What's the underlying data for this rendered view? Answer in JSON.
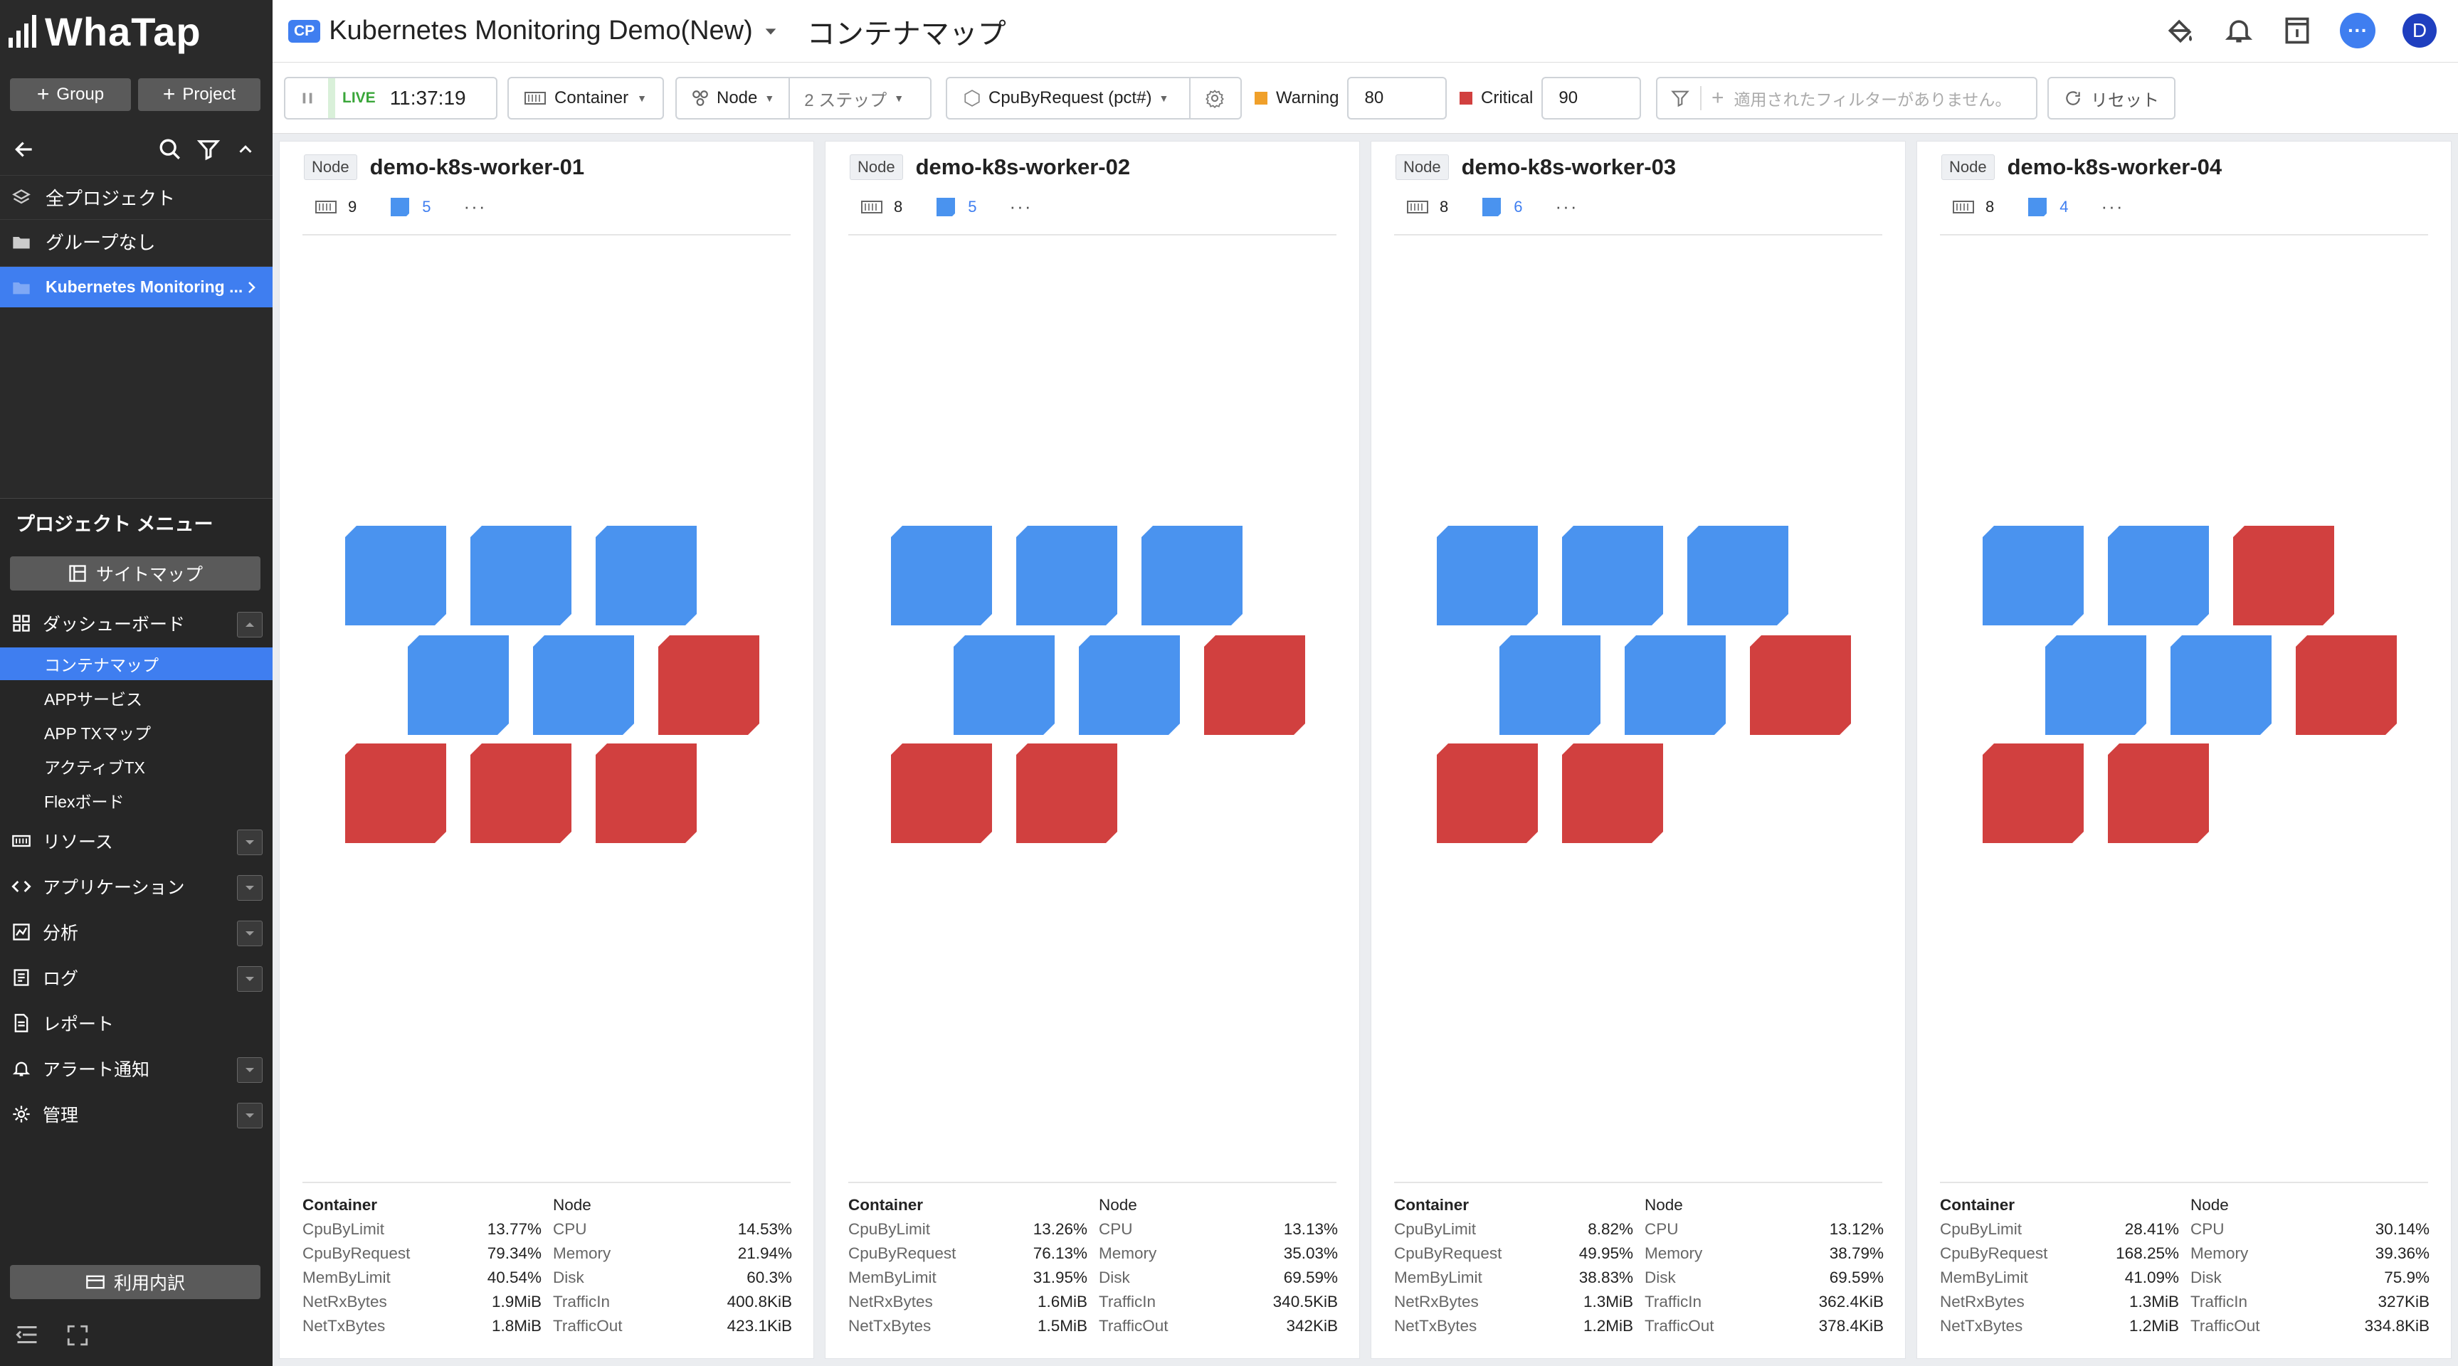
{
  "app": {
    "logo": "WhaTap"
  },
  "sidebar": {
    "add_group": "Group",
    "add_project": "Project",
    "projects": [
      {
        "label": "全プロジェクト",
        "icon": "layers-icon"
      },
      {
        "label": "グループなし",
        "icon": "folder-icon"
      },
      {
        "label": "Kubernetes Monitoring ...",
        "icon": "folder-icon",
        "active": true
      }
    ],
    "menu_title": "プロジェクト メニュー",
    "sitemap": "サイトマップ",
    "dashboard": "ダッシューボード",
    "dashboard_items": [
      "コンテナマップ",
      "APPサービス",
      "APP TXマップ",
      "アクティブTX",
      "Flexボード"
    ],
    "menu": [
      "リソース",
      "アプリケーション",
      "分析",
      "ログ",
      "レポート",
      "アラート通知",
      "管理"
    ],
    "usage": "利用内訳"
  },
  "topbar": {
    "badge": "CP",
    "project": "Kubernetes Monitoring Demo(New)",
    "page_title": "コンテナマップ",
    "avatar": "D"
  },
  "toolbar": {
    "live": "LIVE",
    "time": "11:37:19",
    "view": "Container",
    "group": "Node",
    "steps": "2 ステップ",
    "metric": "CpuByRequest (pct#)",
    "warning_label": "Warning",
    "warning_value": "80",
    "critical_label": "Critical",
    "critical_value": "90",
    "filter_placeholder": "適用されたフィルターがありません。",
    "reset": "リセット"
  },
  "colors": {
    "ok": "#4a93ef",
    "critical": "#d1403f",
    "warning": "#f0a02a",
    "accent": "#3f7ef0"
  },
  "nodes": [
    {
      "tag": "Node",
      "name": "demo-k8s-worker-01",
      "hosts": "9",
      "containers": "5",
      "rows": [
        [
          "b",
          "b",
          "b"
        ],
        [
          "b",
          "b",
          "r"
        ],
        [
          "r",
          "r",
          "r"
        ]
      ],
      "stats": [
        [
          "Container",
          "",
          "Node",
          ""
        ],
        [
          "CpuByLimit",
          "13.77%",
          "CPU",
          "14.53%"
        ],
        [
          "CpuByRequest",
          "79.34%",
          "Memory",
          "21.94%"
        ],
        [
          "MemByLimit",
          "40.54%",
          "Disk",
          "60.3%"
        ],
        [
          "NetRxBytes",
          "1.9MiB",
          "TrafficIn",
          "400.8KiB"
        ],
        [
          "NetTxBytes",
          "1.8MiB",
          "TrafficOut",
          "423.1KiB"
        ]
      ]
    },
    {
      "tag": "Node",
      "name": "demo-k8s-worker-02",
      "hosts": "8",
      "containers": "5",
      "rows": [
        [
          "b",
          "b",
          "b"
        ],
        [
          "b",
          "b",
          "r"
        ],
        [
          "r",
          "r"
        ]
      ],
      "stats": [
        [
          "Container",
          "",
          "Node",
          ""
        ],
        [
          "CpuByLimit",
          "13.26%",
          "CPU",
          "13.13%"
        ],
        [
          "CpuByRequest",
          "76.13%",
          "Memory",
          "35.03%"
        ],
        [
          "MemByLimit",
          "31.95%",
          "Disk",
          "69.59%"
        ],
        [
          "NetRxBytes",
          "1.6MiB",
          "TrafficIn",
          "340.5KiB"
        ],
        [
          "NetTxBytes",
          "1.5MiB",
          "TrafficOut",
          "342KiB"
        ]
      ]
    },
    {
      "tag": "Node",
      "name": "demo-k8s-worker-03",
      "hosts": "8",
      "containers": "6",
      "rows": [
        [
          "b",
          "b",
          "b"
        ],
        [
          "b",
          "b",
          "r"
        ],
        [
          "r",
          "r"
        ]
      ],
      "stats": [
        [
          "Container",
          "",
          "Node",
          ""
        ],
        [
          "CpuByLimit",
          "8.82%",
          "CPU",
          "13.12%"
        ],
        [
          "CpuByRequest",
          "49.95%",
          "Memory",
          "38.79%"
        ],
        [
          "MemByLimit",
          "38.83%",
          "Disk",
          "69.59%"
        ],
        [
          "NetRxBytes",
          "1.3MiB",
          "TrafficIn",
          "362.4KiB"
        ],
        [
          "NetTxBytes",
          "1.2MiB",
          "TrafficOut",
          "378.4KiB"
        ]
      ]
    },
    {
      "tag": "Node",
      "name": "demo-k8s-worker-04",
      "hosts": "8",
      "containers": "4",
      "rows": [
        [
          "b",
          "b",
          "r"
        ],
        [
          "b",
          "b",
          "r"
        ],
        [
          "r",
          "r"
        ]
      ],
      "stats": [
        [
          "Container",
          "",
          "Node",
          ""
        ],
        [
          "CpuByLimit",
          "28.41%",
          "CPU",
          "30.14%"
        ],
        [
          "CpuByRequest",
          "168.25%",
          "Memory",
          "39.36%"
        ],
        [
          "MemByLimit",
          "41.09%",
          "Disk",
          "75.9%"
        ],
        [
          "NetRxBytes",
          "1.3MiB",
          "TrafficIn",
          "327KiB"
        ],
        [
          "NetTxBytes",
          "1.2MiB",
          "TrafficOut",
          "334.8KiB"
        ]
      ]
    }
  ]
}
